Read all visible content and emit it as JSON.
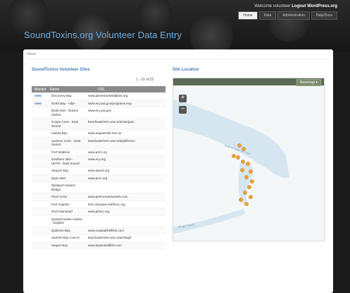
{
  "header": {
    "welcome": "Welcome volunteer",
    "welcome_links": "Logout WordPress.org",
    "site_title": "SoundToxins.org Volunteer Data Entry",
    "nav": [
      "Home",
      "Data",
      "Administration",
      "Help/Docs"
    ]
  },
  "breadcrumb": "Home",
  "sites": {
    "title": "SoundToxins Volunteer Sites",
    "pager": "1 - 22 of 22",
    "columns": [
      "Monitor",
      "Name",
      "URL"
    ],
    "rows": [
      {
        "link": "view",
        "name": "Discovery Bay",
        "url": "www.jamestownsklallam.org"
      },
      {
        "link": "view",
        "name": "North Bay - Allyn",
        "url": "www.ecy.wa.gov/programs.eap"
      },
      {
        "link": "",
        "name": "Budd Inlet - Boston Harbor",
        "url": "www.ecy.wa.gov"
      },
      {
        "link": "",
        "name": "Coupe Cove - East Sound",
        "url": "beachwatchers.wsu.edu/sanjuan"
      },
      {
        "link": "",
        "name": "Liberty Bay",
        "url": "www.suquamish.nsn.us"
      },
      {
        "link": "",
        "name": "Jackson Cove - East Sound",
        "url": "beachwatchers.wsu.edu/jefferson"
      },
      {
        "link": "",
        "name": "Port Madison",
        "url": "www.pscf.org"
      },
      {
        "link": "",
        "name": "Southern Inlet - UETN - East Sound",
        "url": "www.ecy.org"
      },
      {
        "link": "",
        "name": "Sequim Bay",
        "url": "www.spssd.org"
      },
      {
        "link": "",
        "name": "Dyes Inlet",
        "url": "www.pnrc.org"
      },
      {
        "link": "",
        "name": "Westport Historic Bridge",
        "url": ""
      },
      {
        "link": "",
        "name": "Penn Cove",
        "url": "www.penncovemussels.com"
      },
      {
        "link": "",
        "name": "Port Angeles",
        "url": "feiro.olympus.net/fmsc.org"
      },
      {
        "link": "",
        "name": "Port Townsend",
        "url": "www.ptmsc.org"
      },
      {
        "link": "",
        "name": "Quartermaster Harbor - Dolphin",
        "url": ""
      },
      {
        "link": "",
        "name": "Quilcene Bay",
        "url": "www.coastalshellfish.com"
      },
      {
        "link": "",
        "name": "Samish Bay Cove E",
        "url": "beachwatchers.wsu.edu/skagit"
      },
      {
        "link": "",
        "name": "Seguin Bay",
        "url": "www.taylorshellfish.com"
      }
    ]
  },
  "map": {
    "title": "Site Location",
    "basemap_label": "Basemap",
    "zoom_in": "+",
    "zoom_out": "−",
    "water_color": "#cfe3ee",
    "marker_color": "#f0a030",
    "place_labels": [
      "Strait of Juan de Fuca",
      "Puget Sound"
    ]
  }
}
